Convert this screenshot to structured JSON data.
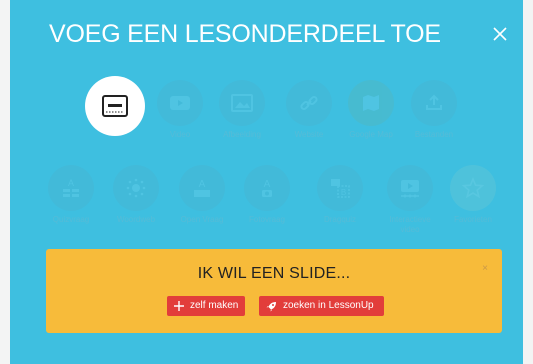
{
  "modal": {
    "title": "VOEG EEN LESONDERDEEL TOE",
    "close_icon": "close-icon"
  },
  "tools_row1": [
    {
      "label": "",
      "icon": "slide-icon",
      "active": true
    },
    {
      "label": "Video",
      "icon": "play-icon"
    },
    {
      "label": "Afbeelding",
      "icon": "image-icon"
    },
    {
      "label": "Website",
      "icon": "link-icon"
    },
    {
      "label": "Google Map",
      "icon": "map-icon"
    },
    {
      "label": "Bestanden",
      "icon": "upload-icon"
    }
  ],
  "tools_row2": [
    {
      "label": "Quizvraag",
      "icon": "quiz-icon"
    },
    {
      "label": "Woordweb",
      "icon": "mindmap-icon"
    },
    {
      "label": "Open Vraag",
      "icon": "open-question-icon"
    },
    {
      "label": "Fotovraag",
      "icon": "photo-question-icon"
    },
    {
      "label": "Dragquiz",
      "icon": "dragquiz-icon"
    },
    {
      "label": "Interactieve video",
      "icon": "interactive-video-icon"
    },
    {
      "label": "Favorieten",
      "icon": "star-icon"
    }
  ],
  "banner": {
    "title": "IK WIL EEN SLIDE...",
    "close": "×",
    "buttons": {
      "make": "zelf maken",
      "search": "zoeken in LessonUp"
    }
  },
  "colors": {
    "modal_bg": "#3ebfe0",
    "banner_bg": "#f7bb3a",
    "button_red": "#e23d3a"
  }
}
